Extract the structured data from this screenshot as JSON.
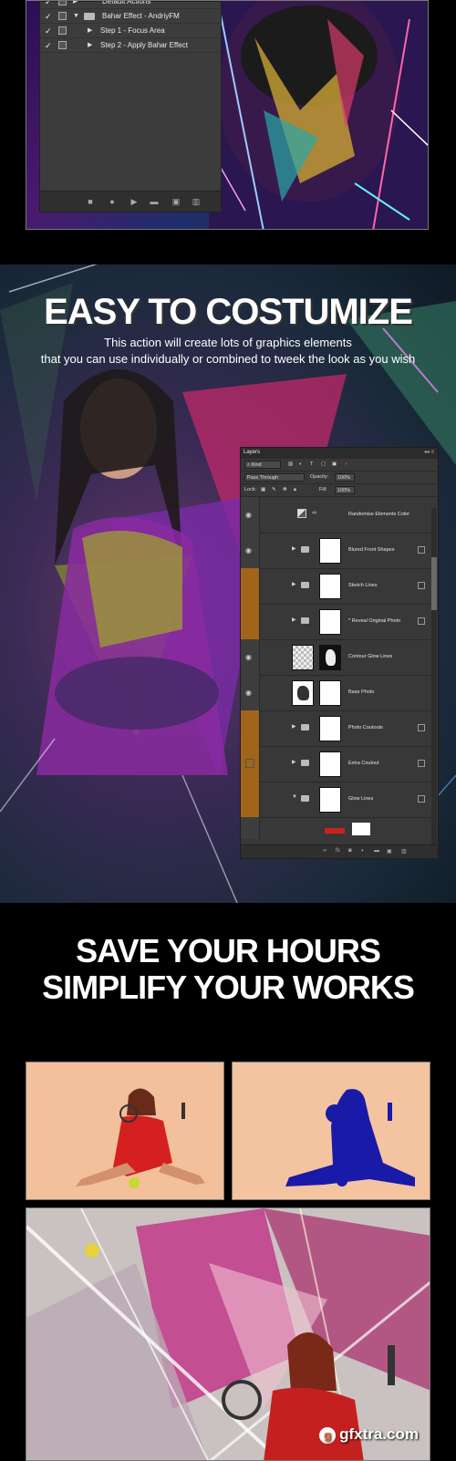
{
  "actions_panel": {
    "rows": [
      {
        "label": "Default Actions",
        "indent": "set",
        "expanded": false
      },
      {
        "label": "Bahar Effect - AndriyFM",
        "indent": "set",
        "expanded": true
      },
      {
        "label": "Step 1 - Focus Area",
        "indent": "action",
        "expanded": false
      },
      {
        "label": "Step 2 - Apply Bahar Effect",
        "indent": "action",
        "expanded": false
      }
    ],
    "checkmark": "✓",
    "footer_icons": [
      "stop-icon",
      "record-icon",
      "play-icon",
      "folder-icon",
      "new-action-icon",
      "trash-icon"
    ]
  },
  "promo": {
    "heading": "EASY TO COSTUMIZE",
    "subline_1": "This action will create lots of graphics elements",
    "subline_2": "that you can use individually or combined to tweek the look as you wish"
  },
  "layers_panel": {
    "tab": "Layers",
    "kind_label": "Kind",
    "blend_mode": "Pass Through",
    "opacity_label": "Opacity:",
    "opacity_value": "100%",
    "lock_label": "Lock:",
    "fill_label": "Fill:",
    "fill_value": "100%",
    "layers": [
      {
        "name": "Randomise Elements Color",
        "type": "adjustment",
        "eye": "gray"
      },
      {
        "name": "Blured Front Shapes",
        "type": "group",
        "eye": "gray"
      },
      {
        "name": "Sketch Lines",
        "type": "group",
        "eye": "orange"
      },
      {
        "name": "* Reveal Original Photo",
        "type": "group",
        "eye": "orange"
      },
      {
        "name": "Contour Glow Lines",
        "type": "layer",
        "eye": "gray"
      },
      {
        "name": "Base Photo",
        "type": "layer",
        "eye": "gray"
      },
      {
        "name": "Photo Coutouts",
        "type": "group",
        "eye": "orange"
      },
      {
        "name": "Extra Coutout",
        "type": "group",
        "eye": "orange"
      },
      {
        "name": "Glow Lines",
        "type": "group-open",
        "eye": "orange"
      }
    ]
  },
  "headline": {
    "line_1": "SAVE YOUR HOURS",
    "line_2": "SIMPLIFY YOUR WORKS"
  },
  "watermark": {
    "text": "gfxtra.com",
    "icon": "g"
  },
  "colors": {
    "panel_bg": "#383838",
    "eye_orange": "#a0651a",
    "accent_red": "#cc2222",
    "peach_bg": "#f4c4a0",
    "mask_blue": "#1a1aa8"
  }
}
